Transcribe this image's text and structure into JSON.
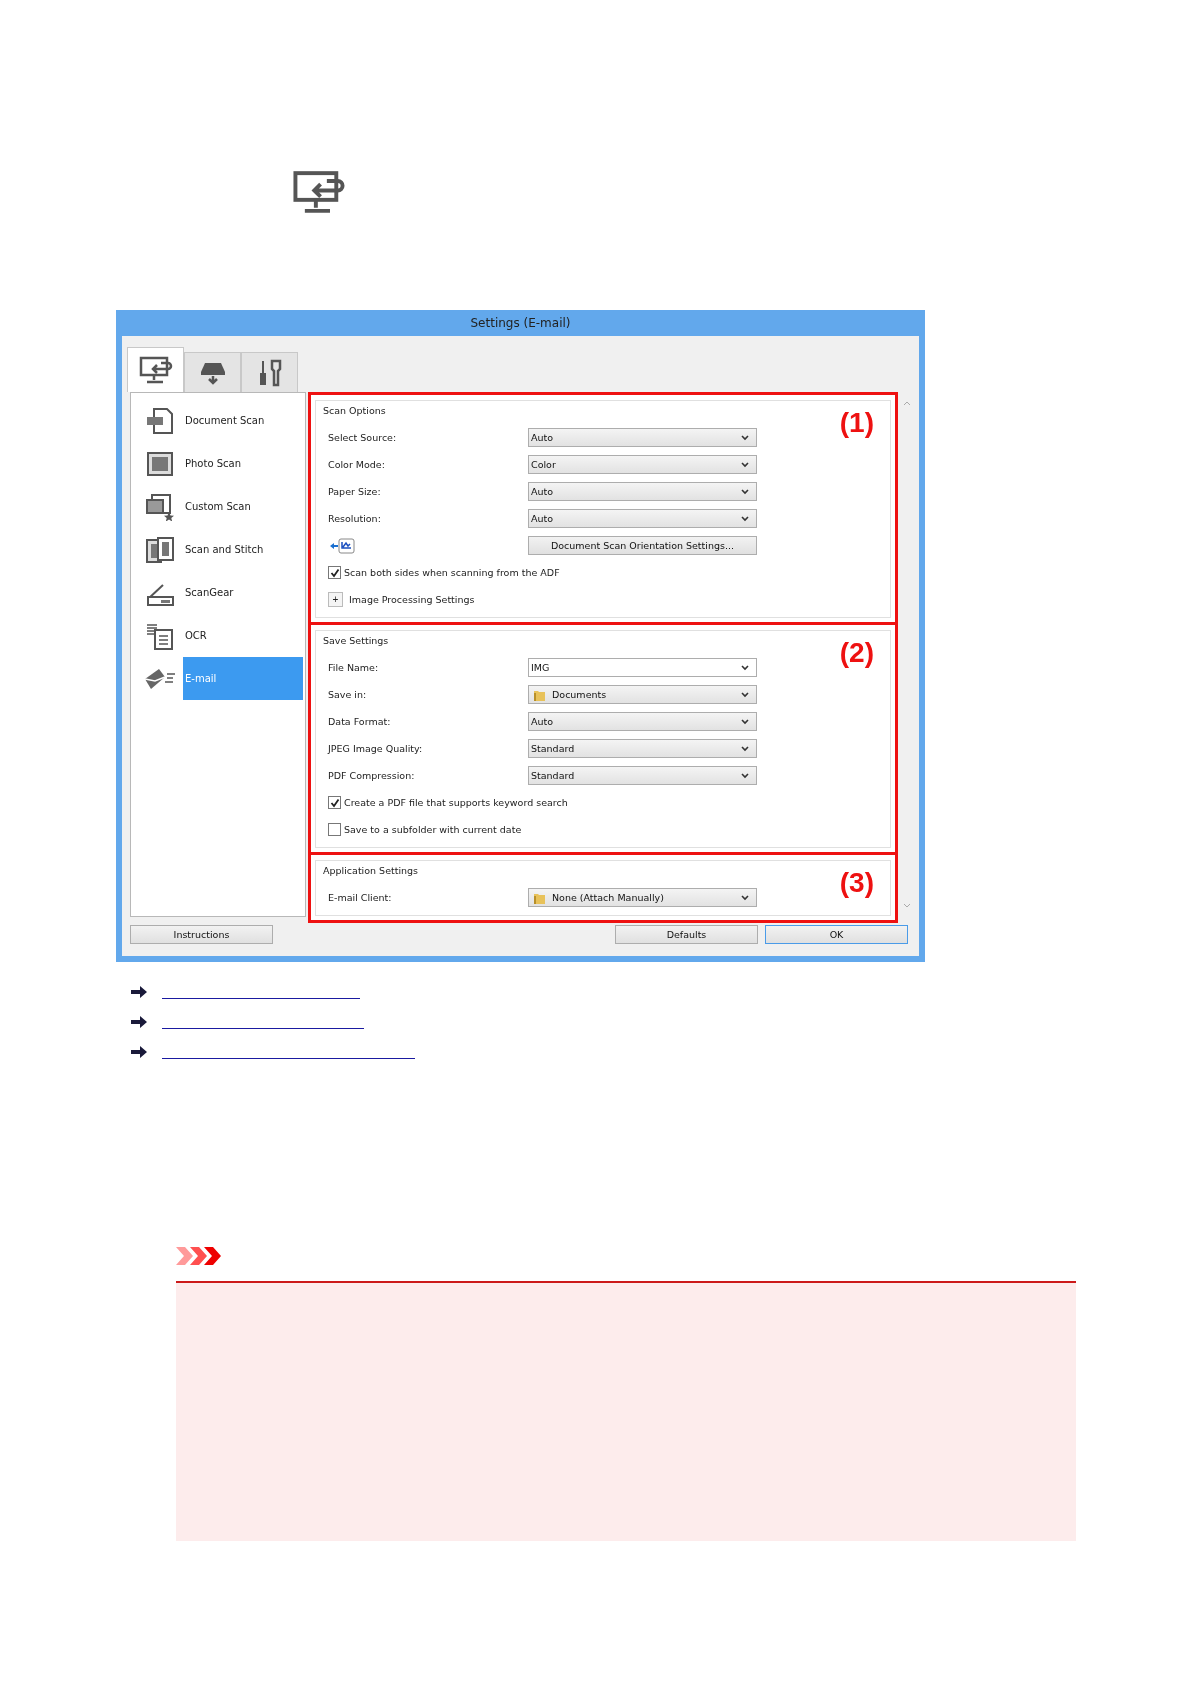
{
  "window": {
    "title": "Settings (E-mail)"
  },
  "tabs": [
    {
      "kind": "computer",
      "selected": true
    },
    {
      "kind": "scanner",
      "selected": false
    },
    {
      "kind": "tools",
      "selected": false
    }
  ],
  "sidebar": {
    "items": [
      {
        "kind": "document",
        "label": "Document Scan",
        "selected": false
      },
      {
        "kind": "photo",
        "label": "Photo Scan",
        "selected": false
      },
      {
        "kind": "custom",
        "label": "Custom Scan",
        "selected": false
      },
      {
        "kind": "stitch",
        "label": "Scan and Stitch",
        "selected": false
      },
      {
        "kind": "scangear",
        "label": "ScanGear",
        "selected": false
      },
      {
        "kind": "ocr",
        "label": "OCR",
        "selected": false
      },
      {
        "kind": "email",
        "label": "E-mail",
        "selected": true
      }
    ]
  },
  "sections": [
    {
      "title": "Scan Options",
      "callout": "(1)",
      "fields": [
        {
          "kind": "dropdown",
          "label": "Select Source:",
          "value": "Auto"
        },
        {
          "kind": "dropdown",
          "label": "Color Mode:",
          "value": "Color"
        },
        {
          "kind": "dropdown",
          "label": "Paper Size:",
          "value": "Auto"
        },
        {
          "kind": "dropdown",
          "label": "Resolution:",
          "value": "Auto"
        },
        {
          "kind": "button",
          "label": "Document Scan Orientation Settings..."
        },
        {
          "kind": "checkbox",
          "label": "Scan both sides when scanning from the ADF",
          "checked": true
        },
        {
          "kind": "expander",
          "label": "Image Processing Settings",
          "symbol": "+"
        }
      ]
    },
    {
      "title": "Save Settings",
      "callout": "(2)",
      "fields": [
        {
          "kind": "textbox",
          "label": "File Name:",
          "value": "IMG"
        },
        {
          "kind": "folder",
          "label": "Save in:",
          "value": "Documents"
        },
        {
          "kind": "dropdown",
          "label": "Data Format:",
          "value": "Auto"
        },
        {
          "kind": "dropdown",
          "label": "JPEG Image Quality:",
          "value": "Standard"
        },
        {
          "kind": "dropdown",
          "label": "PDF Compression:",
          "value": "Standard"
        },
        {
          "kind": "checkbox",
          "label": "Create a PDF file that supports keyword search",
          "checked": true
        },
        {
          "kind": "checkbox",
          "label": "Save to a subfolder with current date",
          "checked": false
        }
      ]
    },
    {
      "title": "Application Settings",
      "callout": "(3)",
      "fields": [
        {
          "kind": "folder",
          "label": "E-mail Client:",
          "value": "None (Attach Manually)"
        }
      ]
    }
  ],
  "buttons": [
    {
      "label": "Instructions",
      "kind": "left"
    },
    {
      "label": "Defaults",
      "kind": "right"
    },
    {
      "label": "OK",
      "kind": "default"
    }
  ],
  "links": [
    {
      "kind": "arrow"
    },
    {
      "kind": "arrow"
    },
    {
      "kind": "arrow"
    }
  ],
  "notice": {
    "kind": "important"
  }
}
